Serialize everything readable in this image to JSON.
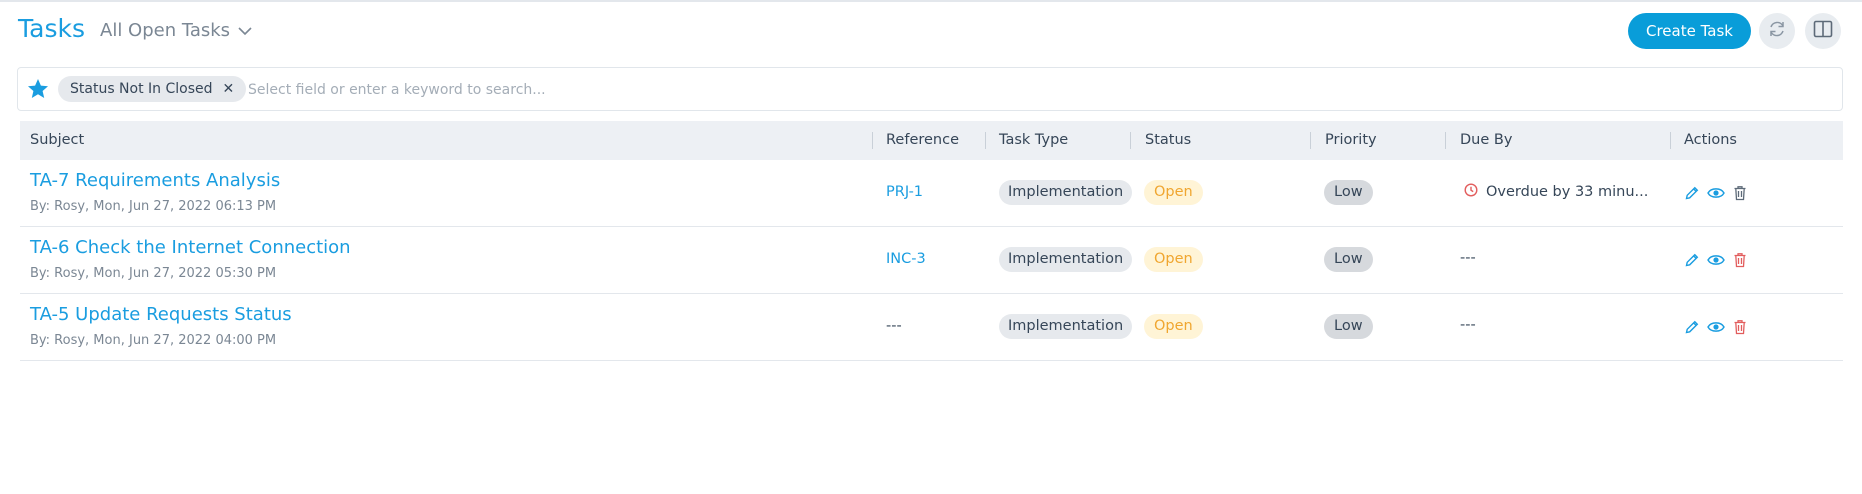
{
  "header": {
    "title": "Tasks",
    "view_label": "All Open Tasks",
    "create_label": "Create Task"
  },
  "search": {
    "chip_label": "Status Not In Closed",
    "placeholder": "Select field or enter a keyword to search..."
  },
  "table": {
    "headers": {
      "subject": "Subject",
      "reference": "Reference",
      "task_type": "Task Type",
      "status": "Status",
      "priority": "Priority",
      "due_by": "Due By",
      "actions": "Actions"
    },
    "rows": [
      {
        "subject": "TA-7 Requirements Analysis",
        "byline": "By: Rosy, Mon, Jun 27, 2022 06:13 PM",
        "reference": "PRJ-1",
        "task_type": "Implementation",
        "status": "Open",
        "priority": "Low",
        "due_by": "Overdue by 33 minu..."
      },
      {
        "subject": "TA-6 Check the Internet Connection",
        "byline": "By: Rosy, Mon, Jun 27, 2022 05:30 PM",
        "reference": "INC-3",
        "task_type": "Implementation",
        "status": "Open",
        "priority": "Low",
        "due_by": "---"
      },
      {
        "subject": "TA-5 Update Requests Status",
        "byline": "By: Rosy, Mon, Jun 27, 2022 04:00 PM",
        "reference": "---",
        "task_type": "Implementation",
        "status": "Open",
        "priority": "Low",
        "due_by": "---"
      }
    ]
  },
  "colors": {
    "accent": "#1a9de0",
    "create_button": "#099dd9",
    "status_open_text": "#f0a630",
    "overdue": "#e25d5d",
    "delete": "#e25d5d"
  }
}
